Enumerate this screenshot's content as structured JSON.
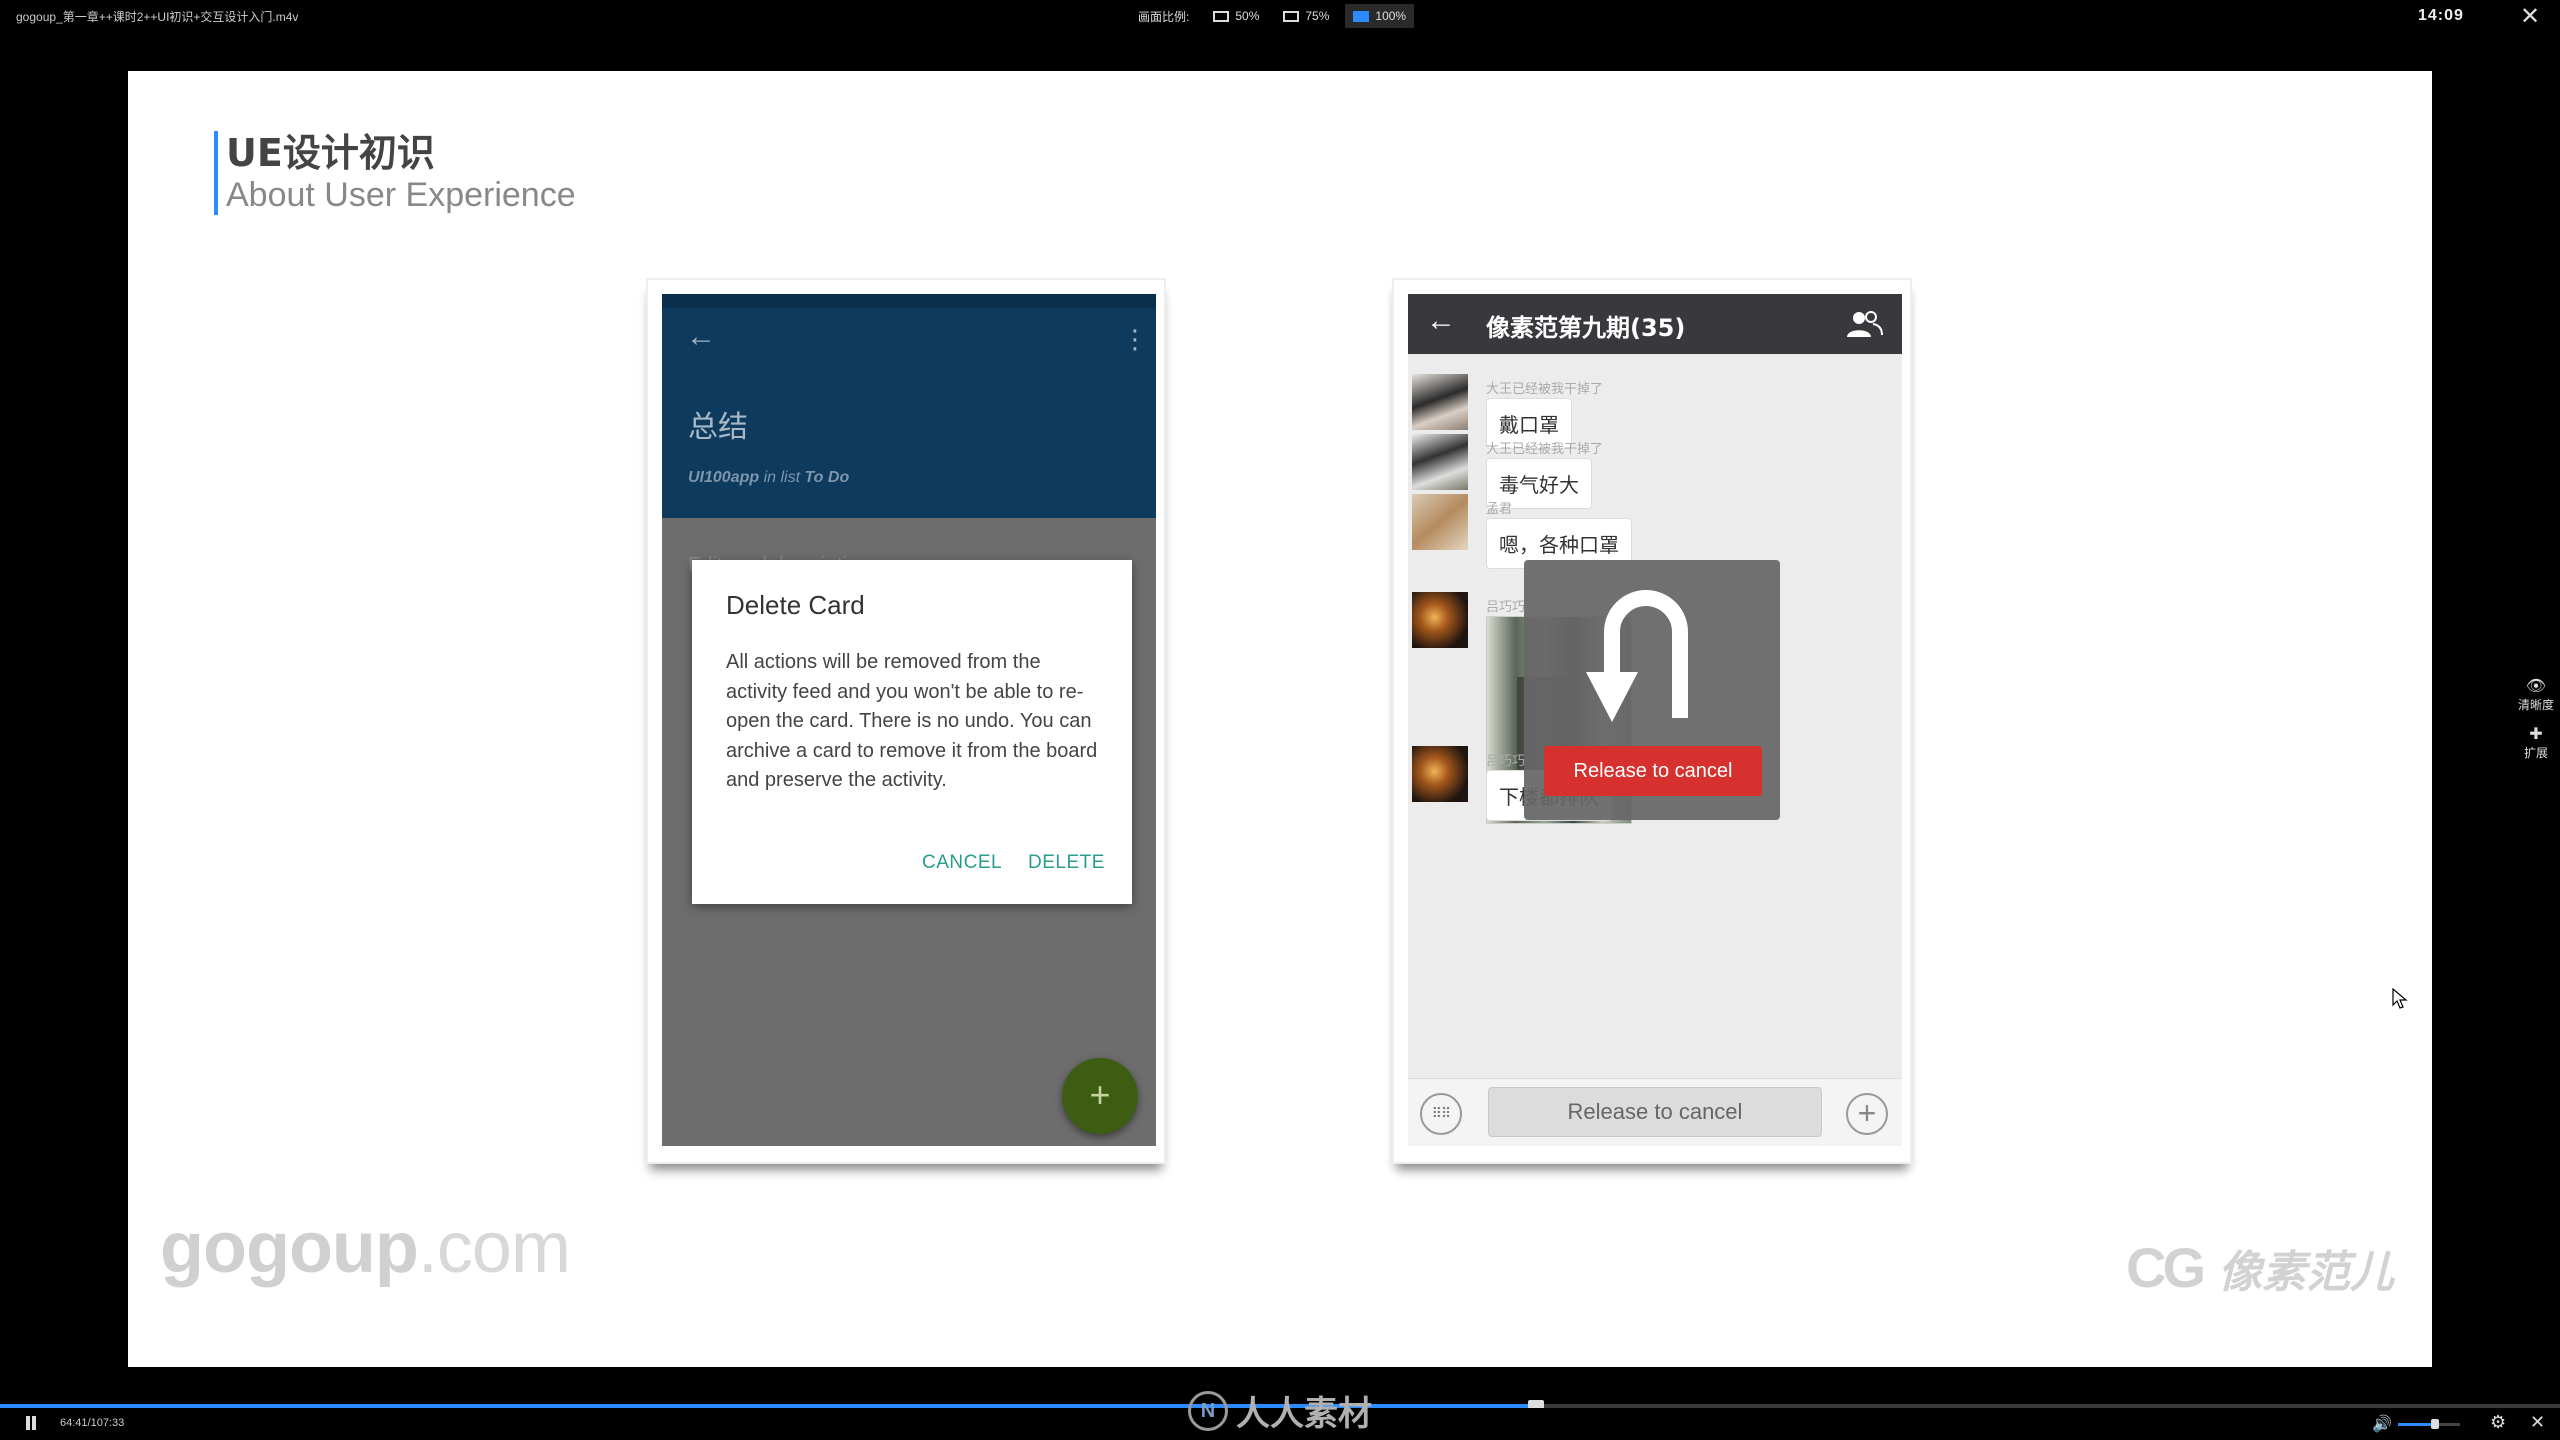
{
  "player": {
    "file_title": "gogoup_第一章++课时2++UI初识+交互设计入门.m4v",
    "ratio_label": "画面比例:",
    "ratio_options": [
      "50%",
      "75%",
      "100%"
    ],
    "clock": "14:09",
    "time_display": "64:41/107:33",
    "progress_fraction": 0.6,
    "volume_fraction": 0.6,
    "side_tools": {
      "quality": "清晰度",
      "expand": "扩展"
    },
    "center_logo": "人人素材"
  },
  "slide": {
    "title_cn": "UE设计初识",
    "title_en": "About User Experience",
    "watermark_left_main": "gogoup",
    "watermark_left_suffix": ".com",
    "watermark_right_cg": "CG",
    "watermark_right_cn": "像素范儿"
  },
  "left_phone": {
    "title": "总结",
    "subtitle_app": "UI100app",
    "subtitle_mid": " in list ",
    "subtitle_list": "To Do",
    "desc_hint": "Edit card description",
    "dialog": {
      "title": "Delete Card",
      "body": "All actions will be removed from the activity feed and you won't be able to re-open the card. There is no undo. You can archive a card to remove it from the board and preserve the activity.",
      "cancel": "CANCEL",
      "delete": "DELETE"
    },
    "fab": "+"
  },
  "right_phone": {
    "group_title": "像素范第九期(35)",
    "messages": [
      {
        "sender": "大王已经被我干掉了",
        "text": "戴口罩"
      },
      {
        "sender": "大王已经被我干掉了",
        "text": "毒气好大"
      },
      {
        "sender": "孟君",
        "text": "嗯，各种口罩"
      },
      {
        "sender": "吕巧巧",
        "text": ""
      },
      {
        "sender": "吕巧巧",
        "text": "下楼都排队"
      }
    ],
    "overlay_label": "Release to cancel",
    "hold_button": "Release to cancel"
  }
}
